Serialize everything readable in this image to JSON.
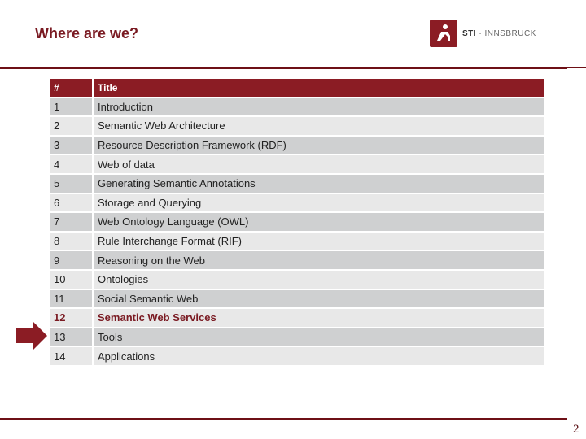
{
  "header": {
    "title": "Where are we?",
    "logo_bold": "STI",
    "logo_text": " · INNSBRUCK"
  },
  "table": {
    "columns": [
      "#",
      "Title"
    ],
    "rows": [
      {
        "num": "1",
        "title": "Introduction"
      },
      {
        "num": "2",
        "title": "Semantic Web Architecture"
      },
      {
        "num": "3",
        "title": "Resource Description Framework (RDF)"
      },
      {
        "num": "4",
        "title": "Web of data"
      },
      {
        "num": "5",
        "title": "Generating Semantic Annotations"
      },
      {
        "num": "6",
        "title": "Storage and Querying"
      },
      {
        "num": "7",
        "title": "Web Ontology Language (OWL)"
      },
      {
        "num": "8",
        "title": "Rule Interchange Format (RIF)"
      },
      {
        "num": "9",
        "title": "Reasoning on the Web"
      },
      {
        "num": "10",
        "title": "Ontologies"
      },
      {
        "num": "11",
        "title": "Social Semantic Web"
      },
      {
        "num": "12",
        "title": "Semantic Web Services"
      },
      {
        "num": "13",
        "title": "Tools"
      },
      {
        "num": "14",
        "title": "Applications"
      }
    ],
    "current_index": 11
  },
  "footer": {
    "page_number": "2"
  },
  "colors": {
    "accent": "#8b1c24",
    "title": "#7a1a22"
  }
}
